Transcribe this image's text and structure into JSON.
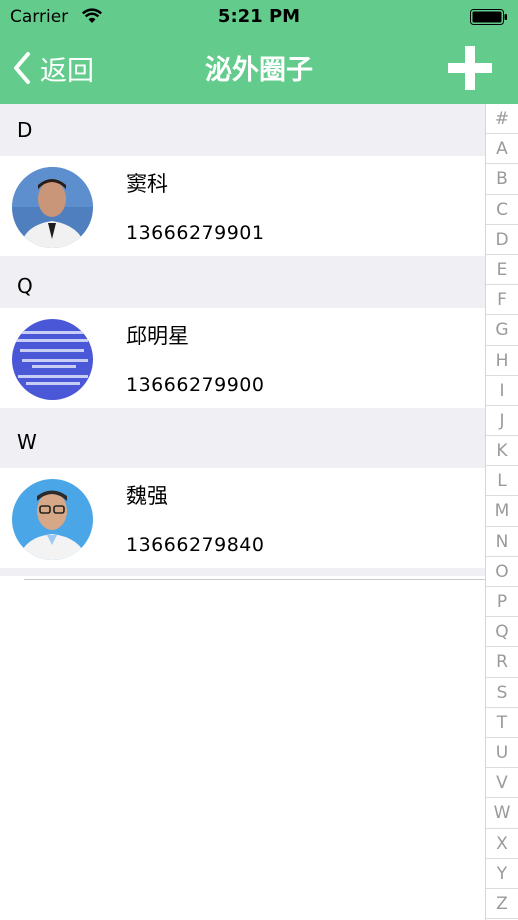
{
  "status_bar": {
    "carrier": "Carrier",
    "time": "5:21 PM"
  },
  "nav": {
    "back_label": "返回",
    "title": "泌外圈子"
  },
  "sections": [
    {
      "letter": "D",
      "contacts": [
        {
          "name": "窦科",
          "phone": "13666279901",
          "avatar": "doctor-portrait"
        }
      ]
    },
    {
      "letter": "Q",
      "contacts": [
        {
          "name": "邱明星",
          "phone": "13666279900",
          "avatar": "slide-image"
        }
      ]
    },
    {
      "letter": "W",
      "contacts": [
        {
          "name": "魏强",
          "phone": "13666279840",
          "avatar": "doctor-portrait-glasses"
        }
      ]
    }
  ],
  "index_letters": [
    "#",
    "A",
    "B",
    "C",
    "D",
    "E",
    "F",
    "G",
    "H",
    "I",
    "J",
    "K",
    "L",
    "M",
    "N",
    "O",
    "P",
    "Q",
    "R",
    "S",
    "T",
    "U",
    "V",
    "W",
    "X",
    "Y",
    "Z"
  ],
  "colors": {
    "nav_background": "#63cc8c",
    "section_background": "#efeff4",
    "index_text": "#9a9a9a"
  }
}
